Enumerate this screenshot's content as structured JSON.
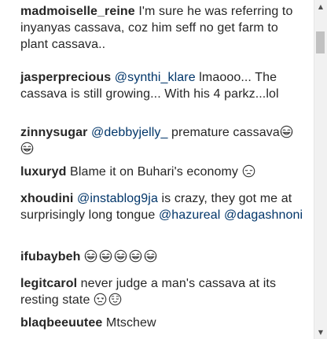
{
  "comments": [
    {
      "username": "madmoiselle_reine",
      "text": " I'm sure he was referring to inyanyas cassava, coz him seff no get farm to plant cassava.."
    },
    {
      "username": "jasperprecious",
      "mention": "@synthi_klare",
      "text": " lmaooo... The cassava is still growing... With his 4 parkz...lol"
    },
    {
      "username": "zinnysugar",
      "mention": "@debbyjelly_",
      "text": " premature cassava",
      "emojis": [
        "laughing-crying-emoji",
        "laughing-crying-emoji"
      ]
    },
    {
      "username": "luxuryd",
      "text": " Blame it on Buhari's economy ",
      "emojis": [
        "pensive-emoji"
      ]
    },
    {
      "username": "xhoudini",
      "mention": "@instablog9ja",
      "text": " is crazy, they got me at surprisingly long tongue ",
      "mention2": "@hazureal",
      "mention3": "@dagashnoni"
    },
    {
      "username": "ifubaybeh",
      "emojis": [
        "laughing-crying-emoji",
        "laughing-crying-emoji",
        "laughing-crying-emoji",
        "laughing-crying-emoji",
        "laughing-crying-emoji"
      ]
    },
    {
      "username": "legitcarol",
      "text": " never judge a man's cassava at its resting state ",
      "emojis": [
        "unamused-emoji",
        "relieved-emoji"
      ]
    },
    {
      "username": "blaqbeeuutee",
      "text": " Mtschew"
    }
  ],
  "colors": {
    "text": "#262626",
    "mention": "#003569",
    "scrollbar_track": "#f1f1f1",
    "scrollbar_thumb": "#c1c1c1"
  }
}
